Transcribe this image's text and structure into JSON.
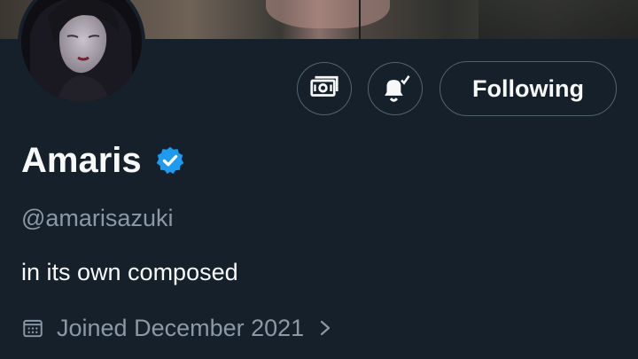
{
  "profile": {
    "display_name": "Amaris",
    "verified": true,
    "handle": "@amarisazuki",
    "bio": "in its own composed",
    "joined": "Joined December 2021"
  },
  "actions": {
    "subscribe_icon": "money-icon",
    "notify_icon": "bell-check-icon",
    "follow_label": "Following"
  },
  "theme": {
    "background": "#15202b",
    "text_primary": "#f7f9f9",
    "text_secondary": "#8b98a5",
    "border": "#536471",
    "verified_blue": "#1d9bf0"
  }
}
